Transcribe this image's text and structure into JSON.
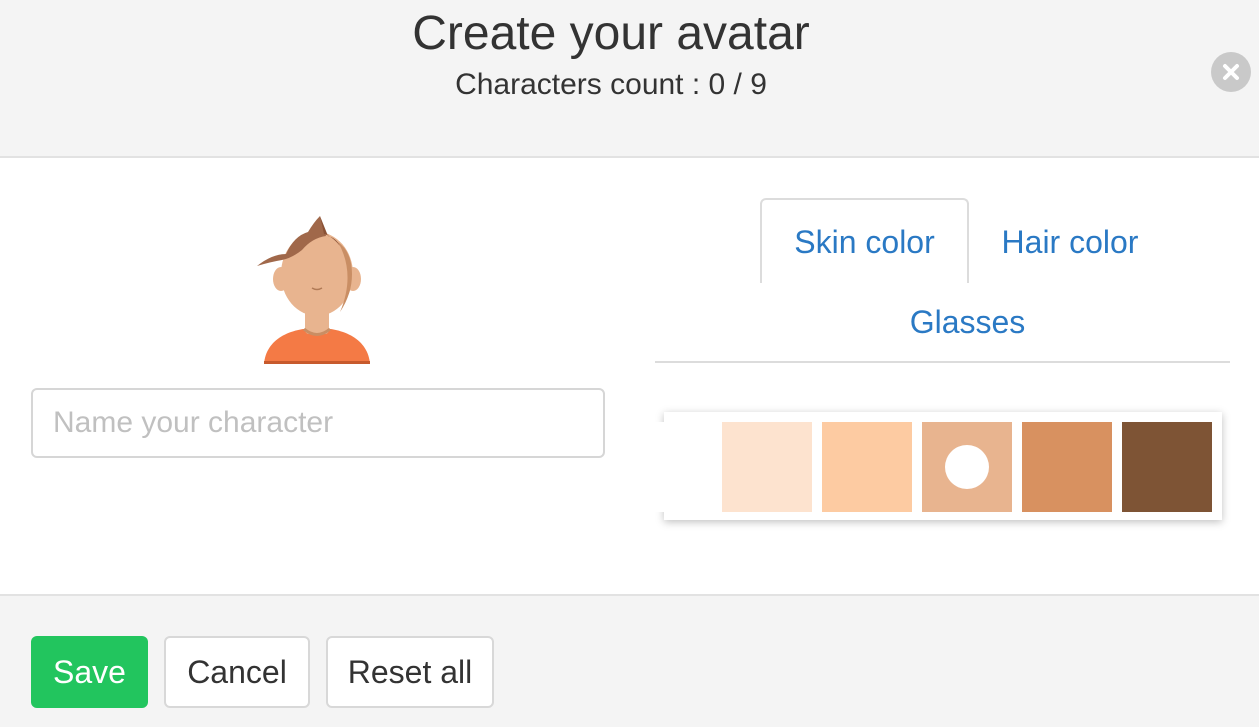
{
  "dialog": {
    "title": "Create your avatar",
    "counter": "Characters count : 0 / 9",
    "close_icon": "close-icon"
  },
  "avatar": {
    "icon": "avatar-preview",
    "skin": "#e8b48f",
    "hair": "#a0684a",
    "shirt": "#f47a45"
  },
  "name_input": {
    "value": "",
    "placeholder": "Name your character"
  },
  "tabs": [
    {
      "label": "Skin color",
      "active": true
    },
    {
      "label": "Hair color",
      "active": false
    },
    {
      "label": "Glasses",
      "active": false
    }
  ],
  "skin_colors": [
    {
      "color": "#ffffff",
      "selected": false
    },
    {
      "color": "#fde3cf",
      "selected": false
    },
    {
      "color": "#fdcba2",
      "selected": false
    },
    {
      "color": "#e8b48f",
      "selected": true
    },
    {
      "color": "#d89160",
      "selected": false
    },
    {
      "color": "#7e5435",
      "selected": false
    }
  ],
  "footer": {
    "save_label": "Save",
    "cancel_label": "Cancel",
    "reset_label": "Reset all",
    "save_color": "#22c55e"
  }
}
